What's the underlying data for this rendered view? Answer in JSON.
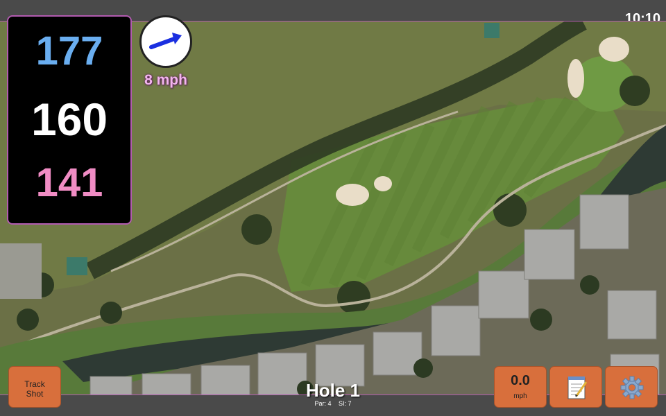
{
  "status_bar": {
    "time": "10:10"
  },
  "distances": {
    "back": "177",
    "middle": "160",
    "front": "141"
  },
  "wind": {
    "speed": "8 mph",
    "icon": "wind-direction-arrow-icon"
  },
  "hole": {
    "title": "Hole 1",
    "par": "Par: 4",
    "stroke_index": "SI: 7"
  },
  "buttons": {
    "track_shot_line1": "Track",
    "track_shot_line2": "Shot",
    "speed_value": "0.0",
    "speed_unit": "mph",
    "notes_icon": "notepad-icon",
    "settings_icon": "gear-icon"
  },
  "colors": {
    "back_distance": "#6aaef0",
    "middle_distance": "#ffffff",
    "front_distance": "#f08cc4",
    "button": "#d86f3c",
    "accent_border": "#b25bb0",
    "wind_arrow": "#1a2fe0"
  }
}
